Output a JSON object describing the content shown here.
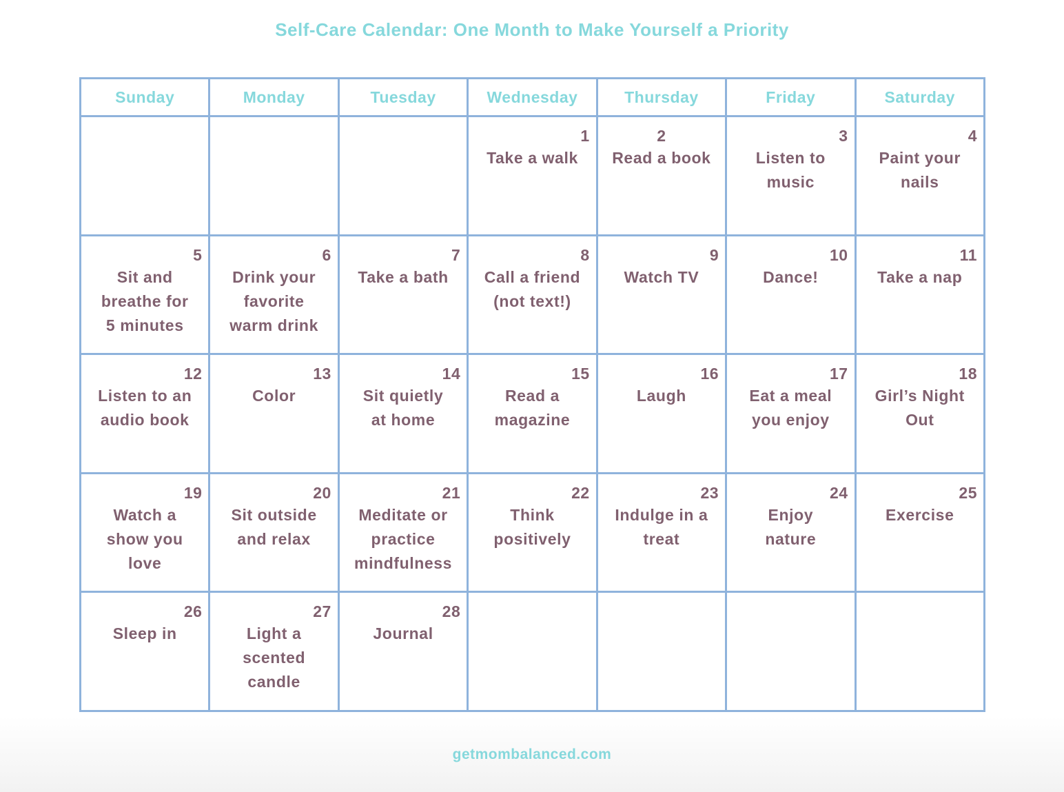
{
  "colors": {
    "accent": "#86d8dc",
    "text": "#80606f",
    "grid": "#8fb3dc"
  },
  "title": "Self-Care Calendar: One Month to Make Yourself a Priority",
  "weekdays": [
    "Sunday",
    "Monday",
    "Tuesday",
    "Wednesday",
    "Thursday",
    "Friday",
    "Saturday"
  ],
  "weeks": [
    [
      {
        "day": "",
        "activity": ""
      },
      {
        "day": "",
        "activity": ""
      },
      {
        "day": "",
        "activity": ""
      },
      {
        "day": "1",
        "activity": "Take a walk"
      },
      {
        "day": "2",
        "activity": "Read a book"
      },
      {
        "day": "3",
        "activity": "Listen to\nmusic"
      },
      {
        "day": "4",
        "activity": "Paint your\nnails"
      }
    ],
    [
      {
        "day": "5",
        "activity": "Sit and\nbreathe for\n5 minutes"
      },
      {
        "day": "6",
        "activity": "Drink your\nfavorite\nwarm drink"
      },
      {
        "day": "7",
        "activity": "Take a bath"
      },
      {
        "day": "8",
        "activity": "Call a friend\n(not text!)"
      },
      {
        "day": "9",
        "activity": "Watch TV"
      },
      {
        "day": "10",
        "activity": "Dance!"
      },
      {
        "day": "11",
        "activity": "Take a nap"
      }
    ],
    [
      {
        "day": "12",
        "activity": "Listen to an\naudio book"
      },
      {
        "day": "13",
        "activity": "Color"
      },
      {
        "day": "14",
        "activity": "Sit quietly\nat home"
      },
      {
        "day": "15",
        "activity": "Read a\nmagazine"
      },
      {
        "day": "16",
        "activity": "Laugh"
      },
      {
        "day": "17",
        "activity": "Eat a meal\nyou enjoy"
      },
      {
        "day": "18",
        "activity": "Girl’s Night\nOut"
      }
    ],
    [
      {
        "day": "19",
        "activity": "Watch a\nshow you\nlove"
      },
      {
        "day": "20",
        "activity": "Sit outside\nand relax"
      },
      {
        "day": "21",
        "activity": "Meditate or\npractice\nmindfulness"
      },
      {
        "day": "22",
        "activity": "Think\npositively"
      },
      {
        "day": "23",
        "activity": "Indulge in a\ntreat"
      },
      {
        "day": "24",
        "activity": "Enjoy\nnature"
      },
      {
        "day": "25",
        "activity": "Exercise"
      }
    ],
    [
      {
        "day": "26",
        "activity": "Sleep in"
      },
      {
        "day": "27",
        "activity": "Light a\nscented\ncandle"
      },
      {
        "day": "28",
        "activity": "Journal"
      },
      {
        "day": "",
        "activity": ""
      },
      {
        "day": "",
        "activity": ""
      },
      {
        "day": "",
        "activity": ""
      },
      {
        "day": "",
        "activity": ""
      }
    ]
  ],
  "footer": "getmombalanced.com"
}
